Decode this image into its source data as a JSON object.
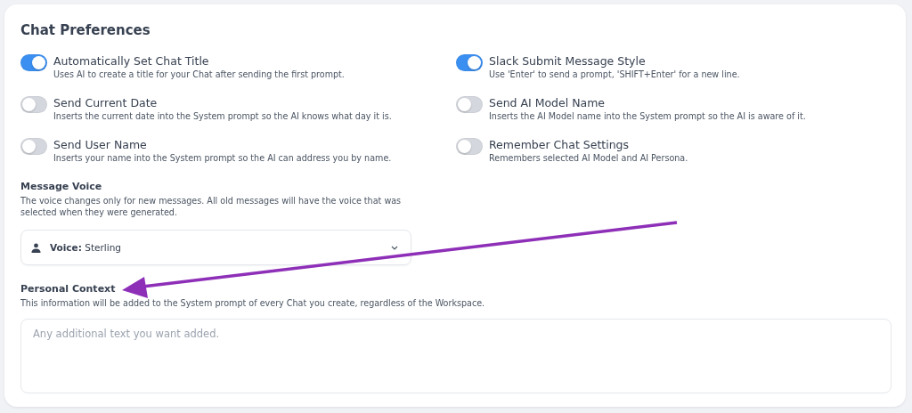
{
  "card": {
    "title": "Chat Preferences"
  },
  "toggles": [
    {
      "label": "Automatically Set Chat Title",
      "description": "Uses AI to create a title for your Chat after sending the first prompt.",
      "on": true
    },
    {
      "label": "Slack Submit Message Style",
      "description": "Use 'Enter' to send a prompt, 'SHIFT+Enter' for a new line.",
      "on": true
    },
    {
      "label": "Send Current Date",
      "description": "Inserts the current date into the System prompt so the AI knows what day it is.",
      "on": false
    },
    {
      "label": "Send AI Model Name",
      "description": "Inserts the AI Model name into the System prompt so the AI is aware of it.",
      "on": false
    },
    {
      "label": "Send User Name",
      "description": "Inserts your name into the System prompt so the AI can address you by name.",
      "on": false
    },
    {
      "label": "Remember Chat Settings",
      "description": "Remembers selected AI Model and AI Persona.",
      "on": false
    }
  ],
  "message_voice": {
    "heading": "Message Voice",
    "description": "The voice changes only for new messages. All old messages will have the voice that was selected when they were generated.",
    "select": {
      "value": "**Voice:** Sterling"
    }
  },
  "personal_context": {
    "heading": "Personal Context",
    "description": "This information will be added to the System prompt of every Chat you create, regardless of the Workspace.",
    "textarea": {
      "placeholder": "Any additional text you want added."
    }
  }
}
